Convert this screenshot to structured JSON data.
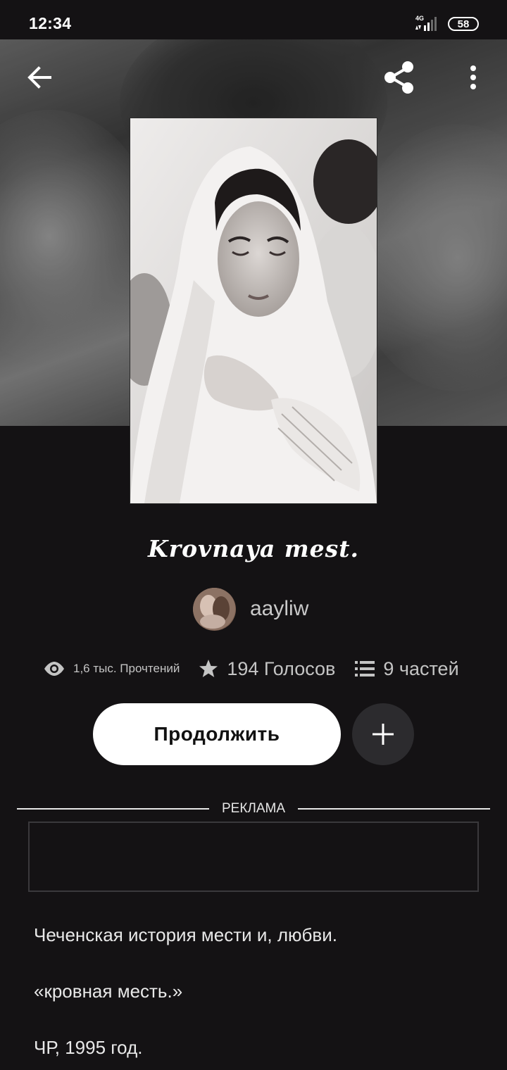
{
  "status_bar": {
    "time": "12:34",
    "network": "4G",
    "battery": "58"
  },
  "toolbar": {
    "back_icon": "arrow-left-icon",
    "share_icon": "share-icon",
    "more_icon": "more-vertical-icon"
  },
  "story": {
    "title": "Krovnaya mest.",
    "author": "aayliw",
    "stats": {
      "reads": "1,6 тыс. Прочтений",
      "votes": "194 Голосов",
      "parts": "9 частей"
    },
    "continue_label": "Продолжить",
    "add_icon": "plus-icon"
  },
  "ad": {
    "label": "РЕКЛАМА"
  },
  "description": {
    "line1": "Чеченская история мести и, любви.",
    "line2": "«кровная месть.»",
    "line3": "ЧР, 1995 год."
  },
  "colors": {
    "background": "#141214",
    "button_primary": "#ffffff",
    "button_secondary": "#2c2b2e",
    "text_muted": "#c4c4c4"
  }
}
